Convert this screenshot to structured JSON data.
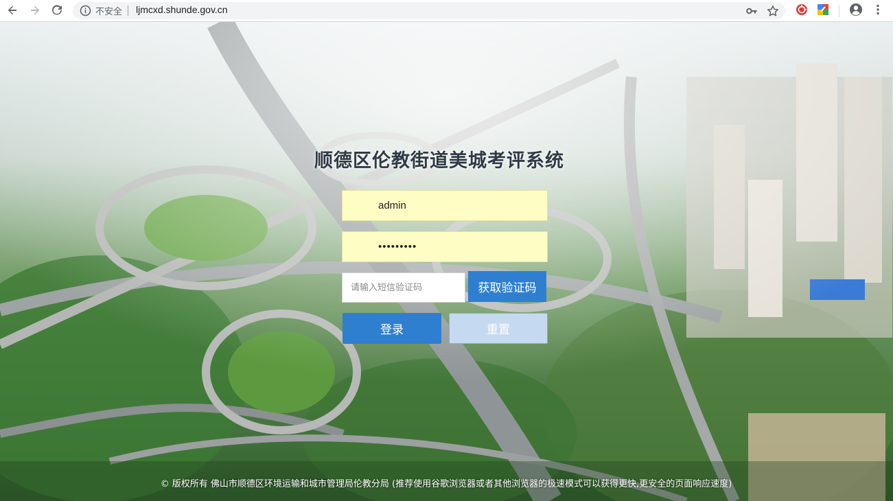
{
  "browser": {
    "security_label": "不安全",
    "url": "ljmcxd.shunde.gov.cn",
    "icons": [
      "back-arrow-icon",
      "forward-arrow-icon",
      "reload-icon",
      "info-icon",
      "key-icon",
      "star-icon",
      "extension-icon",
      "extension-icon",
      "account-icon",
      "menu-icon"
    ]
  },
  "login": {
    "title": "顺德区伦教街道美城考评系统",
    "username_value": "admin",
    "password_value": "•••••••••",
    "sms_placeholder": "请输入短信验证码",
    "get_code_label": "获取验证码",
    "login_label": "登录",
    "reset_label": "重置"
  },
  "footer": {
    "text": "© 版权所有 佛山市顺德区环境运输和城市管理局伦教分局 (推荐使用谷歌浏览器或者其他浏览器的极速模式可以获得更快,更安全的页面响应速度)"
  },
  "colors": {
    "primary_button": "#2f7fd1",
    "reset_button": "#c5daf1",
    "input_autofill": "#fdfdc4"
  }
}
